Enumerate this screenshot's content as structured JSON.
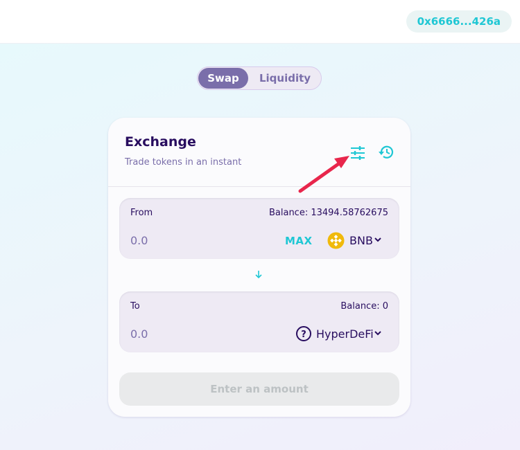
{
  "header": {
    "wallet_address": "0x6666...426a"
  },
  "nav": {
    "swap_label": "Swap",
    "liquidity_label": "Liquidity"
  },
  "exchange": {
    "title": "Exchange",
    "subtitle": "Trade tokens in an instant",
    "settings_icon": "sliders-icon",
    "history_icon": "history-icon"
  },
  "from": {
    "label": "From",
    "balance": "Balance: 13494.58762675",
    "amount": "0.0",
    "max_label": "MAX",
    "token": "BNB"
  },
  "to": {
    "label": "To",
    "balance": "Balance: 0",
    "amount": "0.0",
    "token": "HyperDeFi"
  },
  "action": {
    "label": "Enter an amount"
  },
  "colors": {
    "accent": "#1fc7d4",
    "primary": "#7a6eaa",
    "text": "#280d5f",
    "bnb": "#f0b90b",
    "annotation": "#e8264c"
  }
}
